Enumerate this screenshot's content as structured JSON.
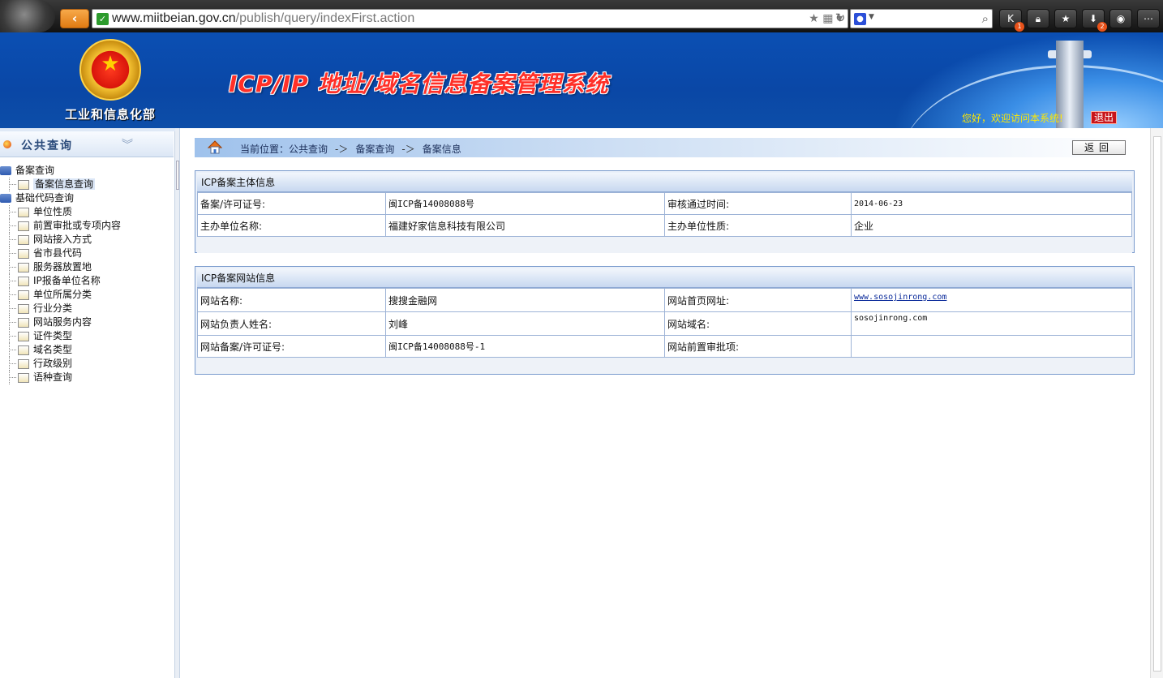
{
  "browser": {
    "url_host": "www.miitbeian.gov.cn",
    "url_path": "/publish/query/indexFirst.action",
    "back_label": "‹",
    "toolbar_badges": [
      "1",
      "2"
    ]
  },
  "header": {
    "ministry_name": "工业和信息化部",
    "system_title": "ICP/IP 地址/域名信息备案管理系统",
    "welcome": "您好，欢迎访问本系统!",
    "logout": "退出"
  },
  "sidebar": {
    "title": "公共查询",
    "items": [
      {
        "label": "备案查询",
        "type": "folder"
      },
      {
        "label": "备案信息查询",
        "type": "leaf",
        "selected": true
      },
      {
        "label": "基础代码查询",
        "type": "folder"
      },
      {
        "label": "单位性质",
        "type": "leaf"
      },
      {
        "label": "前置审批或专项内容",
        "type": "leaf"
      },
      {
        "label": "网站接入方式",
        "type": "leaf"
      },
      {
        "label": "省市县代码",
        "type": "leaf"
      },
      {
        "label": "服务器放置地",
        "type": "leaf"
      },
      {
        "label": "IP报备单位名称",
        "type": "leaf"
      },
      {
        "label": "单位所属分类",
        "type": "leaf"
      },
      {
        "label": "行业分类",
        "type": "leaf"
      },
      {
        "label": "网站服务内容",
        "type": "leaf"
      },
      {
        "label": "证件类型",
        "type": "leaf"
      },
      {
        "label": "域名类型",
        "type": "leaf"
      },
      {
        "label": "行政级别",
        "type": "leaf"
      },
      {
        "label": "语种查询",
        "type": "leaf"
      }
    ]
  },
  "breadcrumb": {
    "current": "当前位置：公共查询",
    "sep": "-＞",
    "level2": "备案查询",
    "level3": "备案信息"
  },
  "return_button": "返回",
  "entity_panel": {
    "title": "ICP备案主体信息",
    "license_label": "备案/许可证号:",
    "license_value": "闽ICP备14008088号",
    "approve_label": "审核通过时间:",
    "approve_value": "2014-06-23",
    "org_label": "主办单位名称:",
    "org_value": "福建好家信息科技有限公司",
    "nature_label": "主办单位性质:",
    "nature_value": "企业"
  },
  "site_panel": {
    "title": "ICP备案网站信息",
    "name_label": "网站名称:",
    "name_value": "搜搜金融网",
    "home_label": "网站首页网址:",
    "home_value": "www.sosojinrong.com",
    "owner_label": "网站负责人姓名:",
    "owner_value": "刘峰",
    "domain_label": "网站域名:",
    "domain_value": "sosojinrong.com",
    "site_license_label": "网站备案/许可证号:",
    "site_license_value": "闽ICP备14008088号-1",
    "preapproval_label": "网站前置审批项:",
    "preapproval_value": ""
  }
}
